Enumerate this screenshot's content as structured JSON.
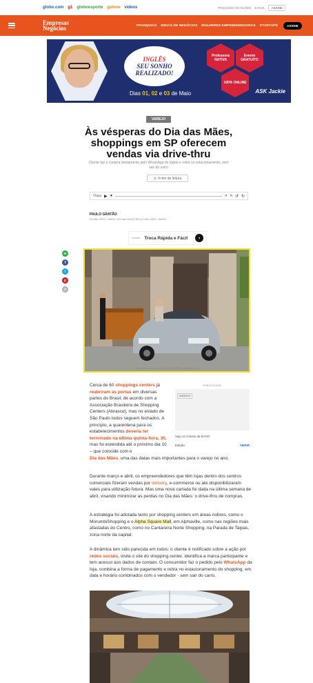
{
  "globo_bar": {
    "links": [
      {
        "label": "globo.com",
        "color": "#1d5fbf"
      },
      {
        "label": "g1",
        "color": "#c4170c"
      },
      {
        "label": "globoesporte",
        "color": "#3aa335"
      },
      {
        "label": "gshow",
        "color": "#f48120"
      },
      {
        "label": "vídeos",
        "color": "#1d5fbf"
      }
    ],
    "search_label": "PESQUISE NO GLOBO",
    "mail_label": "E-MAIL",
    "login_label": "ASSINE"
  },
  "header": {
    "logo_line1": "Empresas",
    "logo_line2": "Negócios",
    "nav": [
      "FRANQUIAS",
      "IDEIAS DE NEGÓCIOS",
      "MULHERES EMPREENDEDORAS",
      "STARTUPS"
    ],
    "assine": "ASSINE",
    "brand_color": "#e8541e"
  },
  "banner": {
    "cloud_line1": "INGLÊS",
    "cloud_line2": "SEU SONHO",
    "cloud_line3": "REALIZADO!",
    "dates_prefix": "Dias",
    "dates_bold1": "01,",
    "dates_bold2": "02",
    "dates_mid": "e",
    "dates_bold3": "03",
    "dates_suffix": "de Maio",
    "hex1": "Professora NATIVA",
    "hex2": "Evento GRATUITO",
    "hex3": "100% ONLINE",
    "brand": "ASK Jackie"
  },
  "article": {
    "category": "VAREJO",
    "title": "Às vésperas do Dia das Mães, shoppings em SP oferecem vendas via drive-thru",
    "subtitle": "Cliente faz a compra diretamente pelo WhatsApp do lojista e retira no estacionamento, sem sair do carro",
    "read_time": "4 min de leitura",
    "player_label": "Ouça",
    "author": "PAULO GRATÃO",
    "date": "01 MAI 2020 - 06H11 | ATUALIZADO EM 01 MAI 2020 - 06H11",
    "photo_caption": "Drive-thru no Alpha Square Mall (Foto: Divulgação)"
  },
  "sponsor": {
    "small": "anúncio",
    "label": "Troca Rápida e Fácil"
  },
  "body": {
    "p1_a": "Cerca de 60 ",
    "p1_b": "shoppings centers",
    "p1_c": " já ",
    "p1_d": "reabriram as portas",
    "p1_e": " em diversas partes do Brasil, de acordo com a Associação Brasileira de Shopping Centers (Abrasce), mas no estado de São Paulo todos seguem fechados. A princípio, a quarentena para os estabelecimentos ",
    "p1_f": "deveria ter terminado na última quinta-feira, 30,",
    "p1_g": " mas foi estendida até o próximo dia 10 – que coincide com o",
    "p1_h": "Dia das Mães",
    "p1_i": ", uma das datas mais importantes para o varejo no ano.",
    "p2_a": "Durante março e abril, os empreendedores que têm lojas dentro dos centros comerciais fizeram vendas por ",
    "p2_b": "delivery",
    "p2_c": ", e-commerce ou até disponibilizaram vales para utilização futura. Mas uma nova cartada foi dada na última semana de abril, visando minimizar as perdas no Dia das Mães: o drive-thru de compras.",
    "p3_a": "A estratégia foi adotada tanto por shopping centers em áreas nobres, como o MorumbiShopping e o ",
    "p3_b": "Alpha Square Mall",
    "p3_c": ", em Alphaville, como nas regiões mais afastadas do Centro, como no Cantareira Norte Shopping, na Parada de Taipas, zona norte da capital.",
    "p4_a": "A dinâmica tem sido parecida em todos: o cliente é notificado sobre a ação por ",
    "p4_b": "redes sociais",
    "p4_c": ", visita o site do shopping center, identifica a marca participante e tem acesso aos dados de contato. O consumidor faz o pedido pelo ",
    "p4_d": "WhatsApp",
    "p4_e": " da loja, combina a forma de pagamento e retira no estacionamento do shopping, em data e horário combinados com o vendedor - sem sair do carro."
  },
  "text_ad": {
    "label": "PUBLICIDADE",
    "mini": "ANÚNCIO",
    "sub": "Veja os Canais da BAGD",
    "left": "Edição",
    "open": "ABRIR"
  },
  "social_icons": [
    {
      "name": "whatsapp-icon",
      "glyph": "w",
      "color": "#25b14a"
    },
    {
      "name": "facebook-icon",
      "glyph": "f",
      "color": "#3b5998"
    },
    {
      "name": "twitter-icon",
      "glyph": "t",
      "color": "#1da1f2"
    },
    {
      "name": "pinterest-icon",
      "glyph": "p",
      "color": "#cb2027"
    },
    {
      "name": "email-icon",
      "glyph": "@",
      "color": "#aaaaaa"
    }
  ]
}
